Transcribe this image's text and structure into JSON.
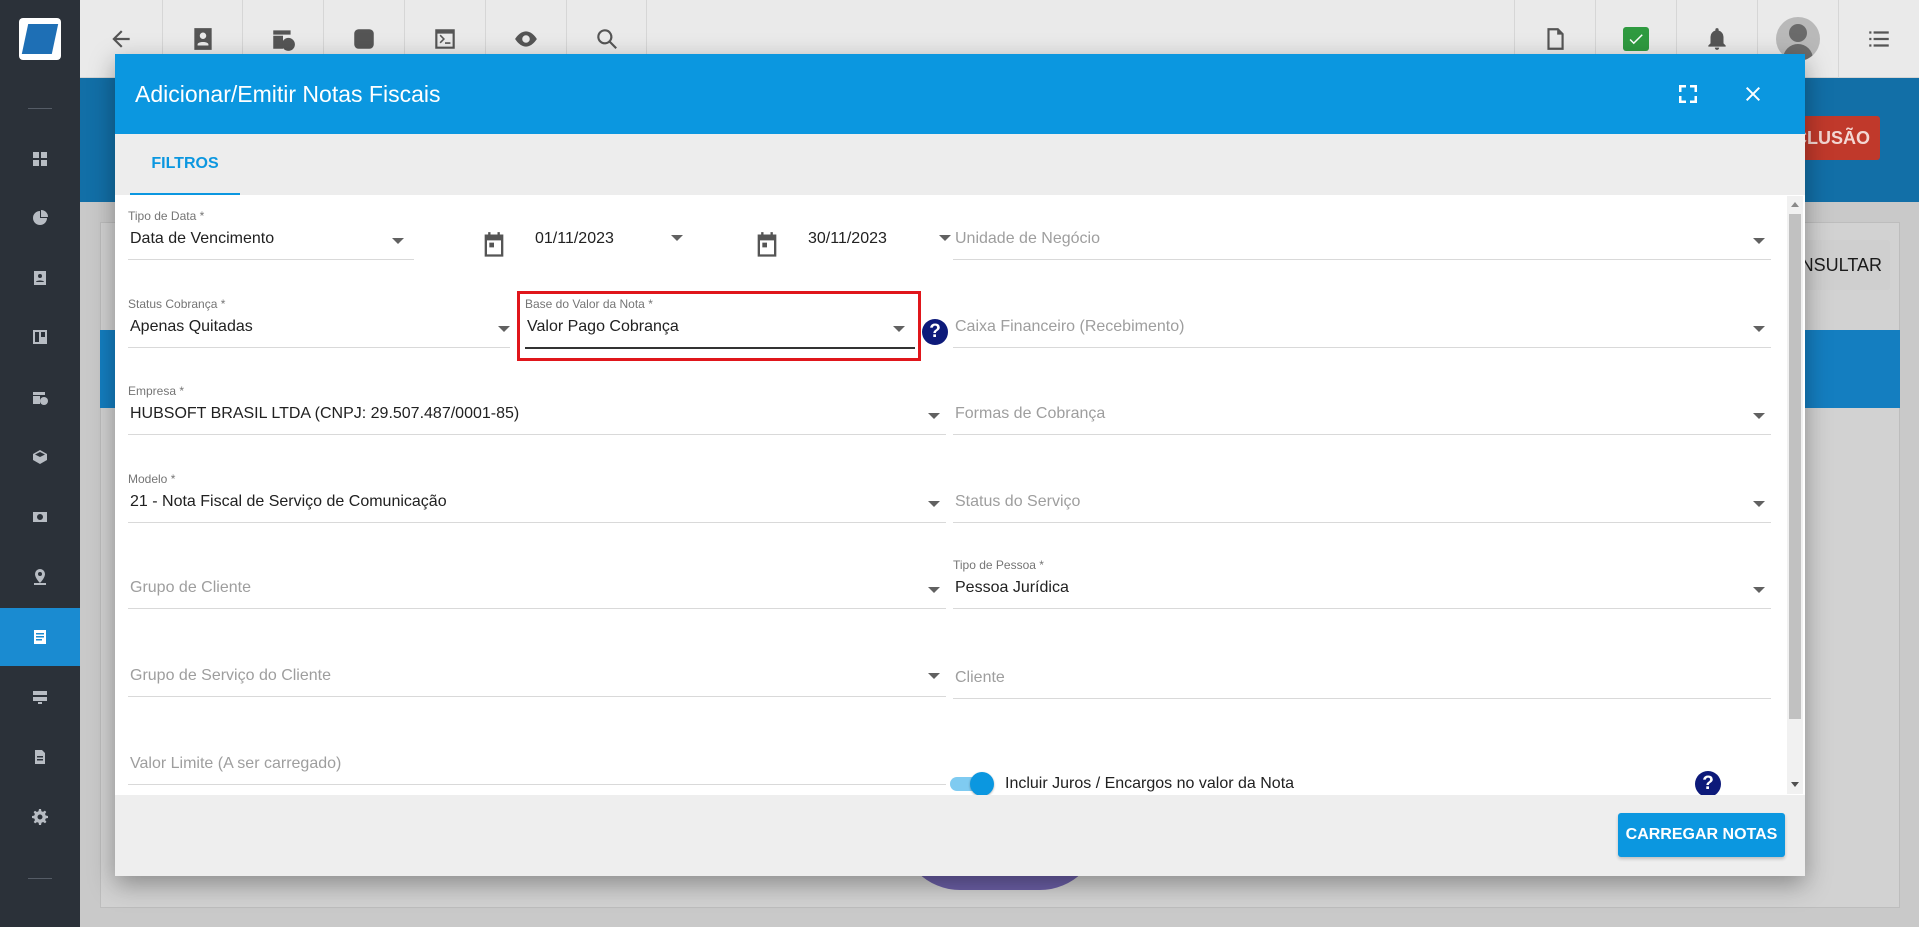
{
  "background": {
    "red_button_label": "CLUSÃO",
    "consult_button_label": "NSULTAR"
  },
  "modal": {
    "title": "Adicionar/Emitir Notas Fiscais",
    "tabs": [
      {
        "label": "FILTROS",
        "active": true
      }
    ],
    "fields": {
      "tipo_data": {
        "label": "Tipo de Data *",
        "value": "Data de Vencimento"
      },
      "data_inicio": {
        "value": "01/11/2023"
      },
      "data_fim": {
        "value": "30/11/2023"
      },
      "unidade_negocio": {
        "placeholder": "Unidade de Negócio"
      },
      "status_cobranca": {
        "label": "Status Cobrança *",
        "value": "Apenas Quitadas"
      },
      "base_valor_nota": {
        "label": "Base do Valor da Nota *",
        "value": "Valor Pago Cobrança"
      },
      "caixa_financeiro": {
        "placeholder": "Caixa Financeiro (Recebimento)"
      },
      "empresa": {
        "label": "Empresa *",
        "value": "HUBSOFT BRASIL LTDA (CNPJ: 29.507.487/0001-85)"
      },
      "formas_cobranca": {
        "placeholder": "Formas de Cobrança"
      },
      "modelo": {
        "label": "Modelo *",
        "value": "21 - Nota Fiscal de Serviço de Comunicação"
      },
      "status_servico": {
        "placeholder": "Status do Serviço"
      },
      "grupo_cliente": {
        "placeholder": "Grupo de Cliente"
      },
      "tipo_pessoa": {
        "label": "Tipo de Pessoa *",
        "value": "Pessoa Jurídica"
      },
      "grupo_servico_cliente": {
        "placeholder": "Grupo de Serviço do Cliente"
      },
      "cliente": {
        "placeholder": "Cliente"
      },
      "valor_limite": {
        "placeholder": "Valor Limite (A ser carregado)"
      }
    },
    "toggle": {
      "label": "Incluir Juros / Encargos no valor da Nota",
      "checked": true
    },
    "help_glyph": "?",
    "submit_label": "CARREGAR NOTAS"
  },
  "colors": {
    "primary": "#0b97e0",
    "highlight": "#e0161b",
    "help": "#0d1a7a",
    "sidebar": "#2b3139"
  },
  "icons": {
    "sidebar": [
      "dashboard-icon",
      "pie-chart-icon",
      "contact-card-icon",
      "kanban-icon",
      "calendar-clock-icon",
      "box-icon",
      "money-icon",
      "map-pin-icon",
      "document-icon",
      "server-icon",
      "file-icon",
      "gear-icon"
    ],
    "topbar": [
      "back-arrow-icon",
      "contact-card-icon",
      "calendar-clock-icon",
      "dollar-icon",
      "terminal-icon",
      "eye-icon",
      "search-icon",
      "pdf-icon",
      "check-icon",
      "bell-icon",
      "avatar",
      "menu-list-icon"
    ]
  }
}
